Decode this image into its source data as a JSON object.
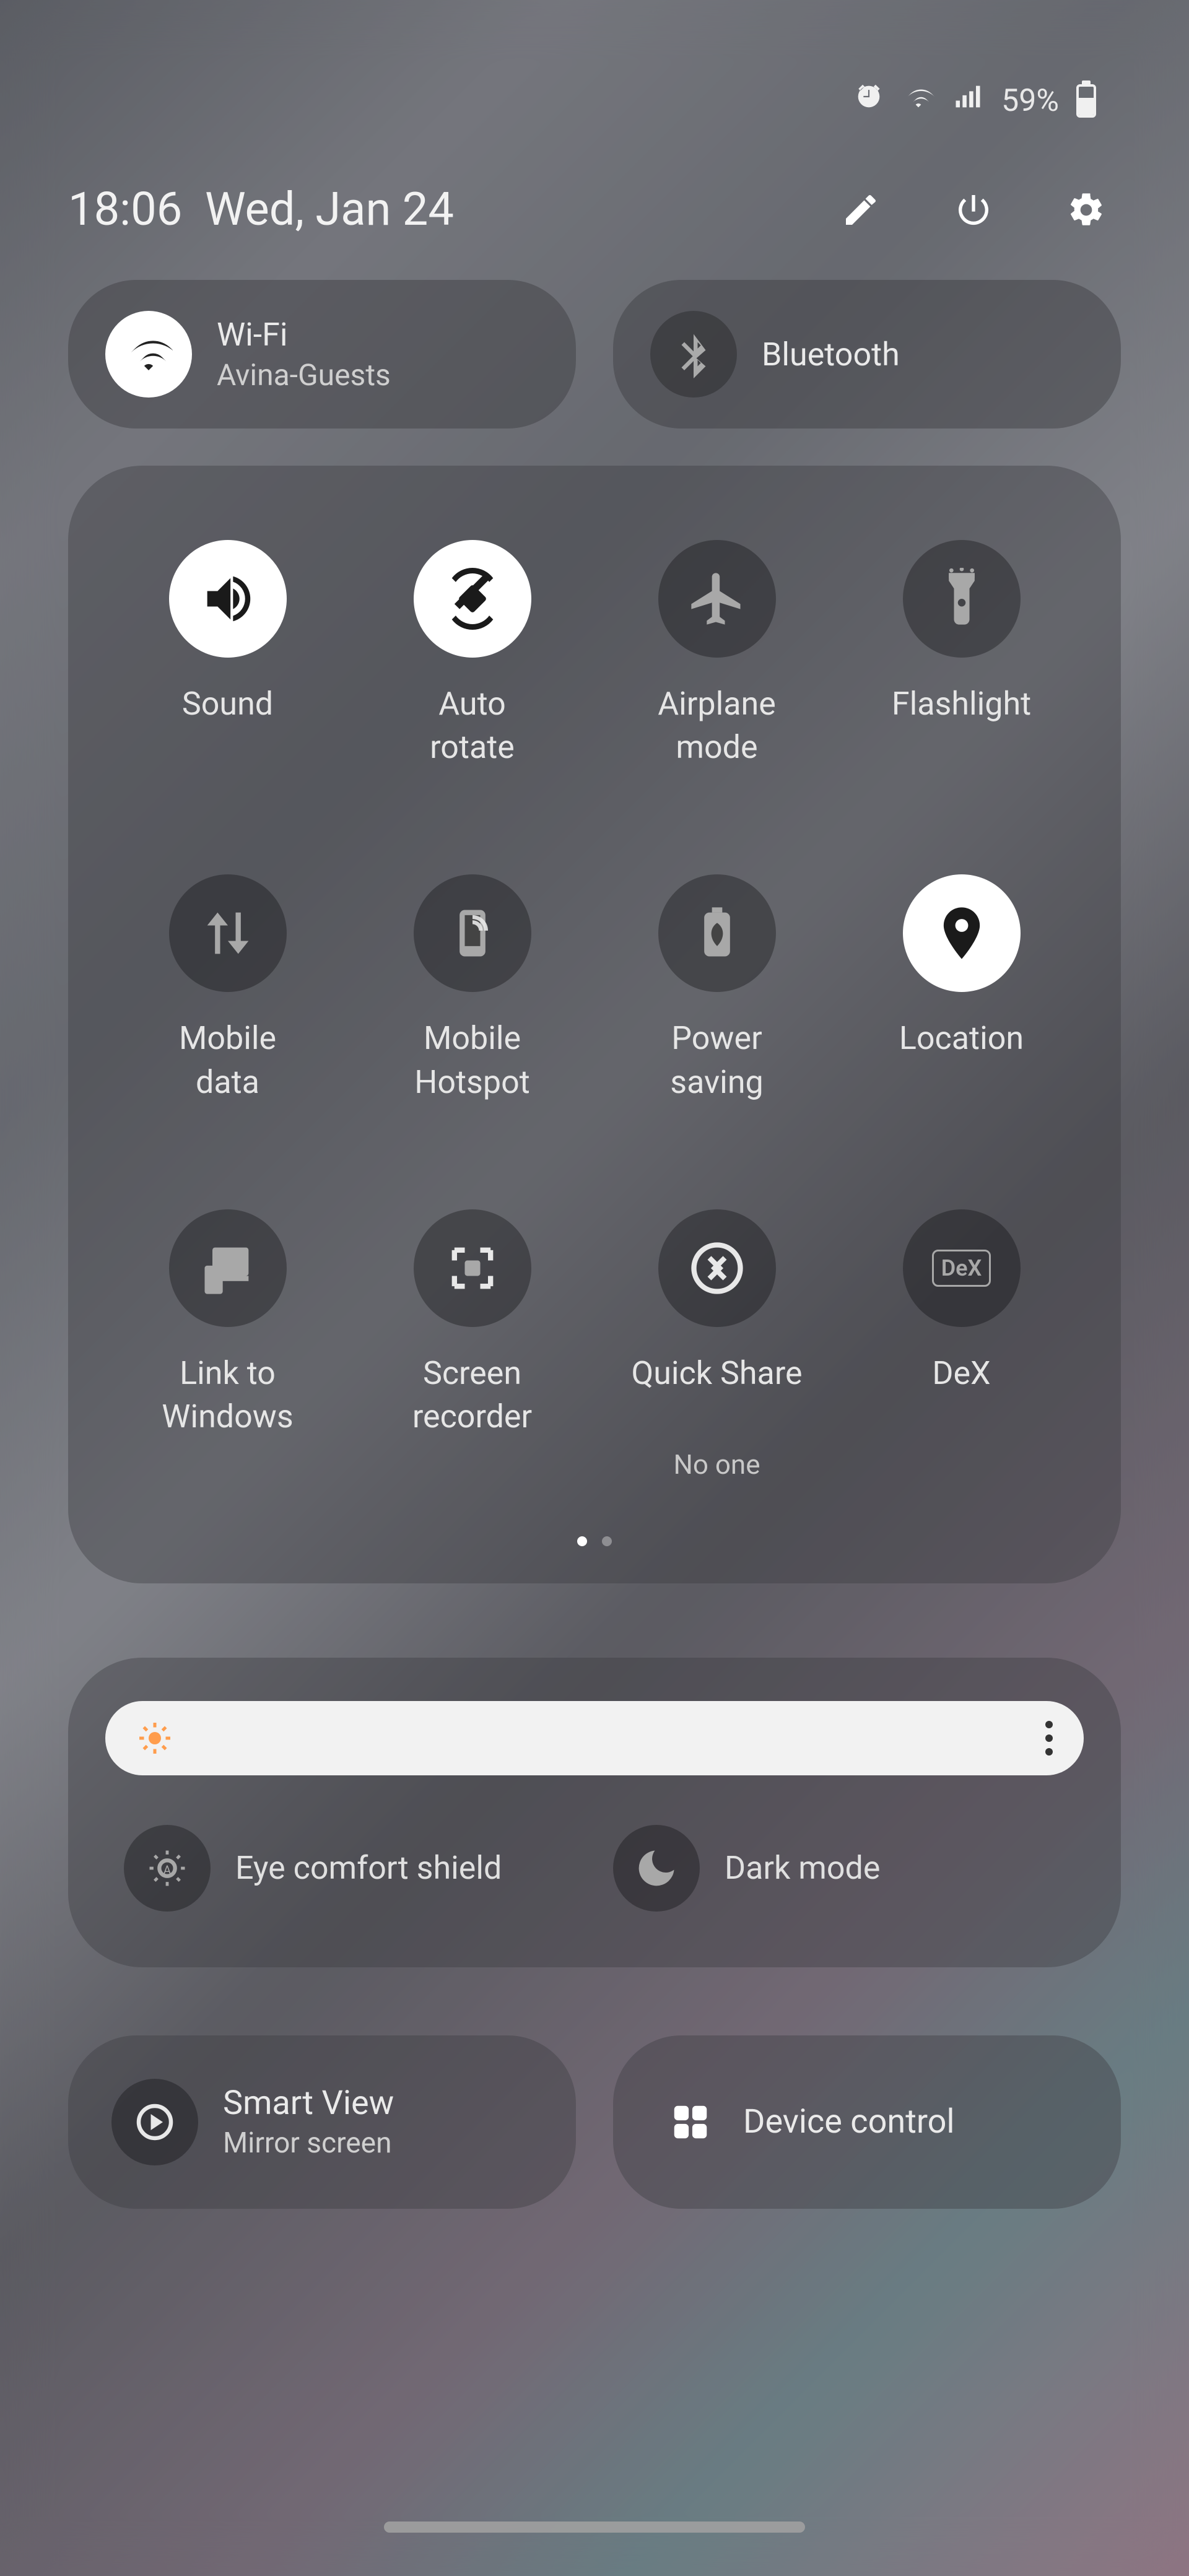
{
  "status": {
    "battery_pct": "59%"
  },
  "header": {
    "time": "18:06",
    "date": "Wed, Jan 24"
  },
  "top_pills": {
    "wifi": {
      "title": "Wi-Fi",
      "sub": "Avina-Guests"
    },
    "bluetooth": {
      "title": "Bluetooth"
    }
  },
  "toggles": [
    {
      "name": "sound",
      "label": "Sound",
      "on": true
    },
    {
      "name": "auto-rotate",
      "label": "Auto\nrotate",
      "on": true
    },
    {
      "name": "airplane-mode",
      "label": "Airplane\nmode",
      "on": false
    },
    {
      "name": "flashlight",
      "label": "Flashlight",
      "on": false
    },
    {
      "name": "mobile-data",
      "label": "Mobile\ndata",
      "on": false
    },
    {
      "name": "mobile-hotspot",
      "label": "Mobile\nHotspot",
      "on": false
    },
    {
      "name": "power-saving",
      "label": "Power\nsaving",
      "on": false
    },
    {
      "name": "location",
      "label": "Location",
      "on": true
    },
    {
      "name": "link-windows",
      "label": "Link to\nWindows",
      "on": false
    },
    {
      "name": "screen-recorder",
      "label": "Screen\nrecorder",
      "on": false
    },
    {
      "name": "quick-share",
      "label": "Quick Share",
      "sub": "No one",
      "on": false
    },
    {
      "name": "dex",
      "label": "DeX",
      "on": false
    }
  ],
  "display": {
    "eye_comfort": "Eye comfort shield",
    "dark_mode": "Dark mode"
  },
  "bottom": {
    "smart_view": {
      "title": "Smart View",
      "sub": "Mirror screen"
    },
    "device_control": {
      "title": "Device control"
    }
  }
}
